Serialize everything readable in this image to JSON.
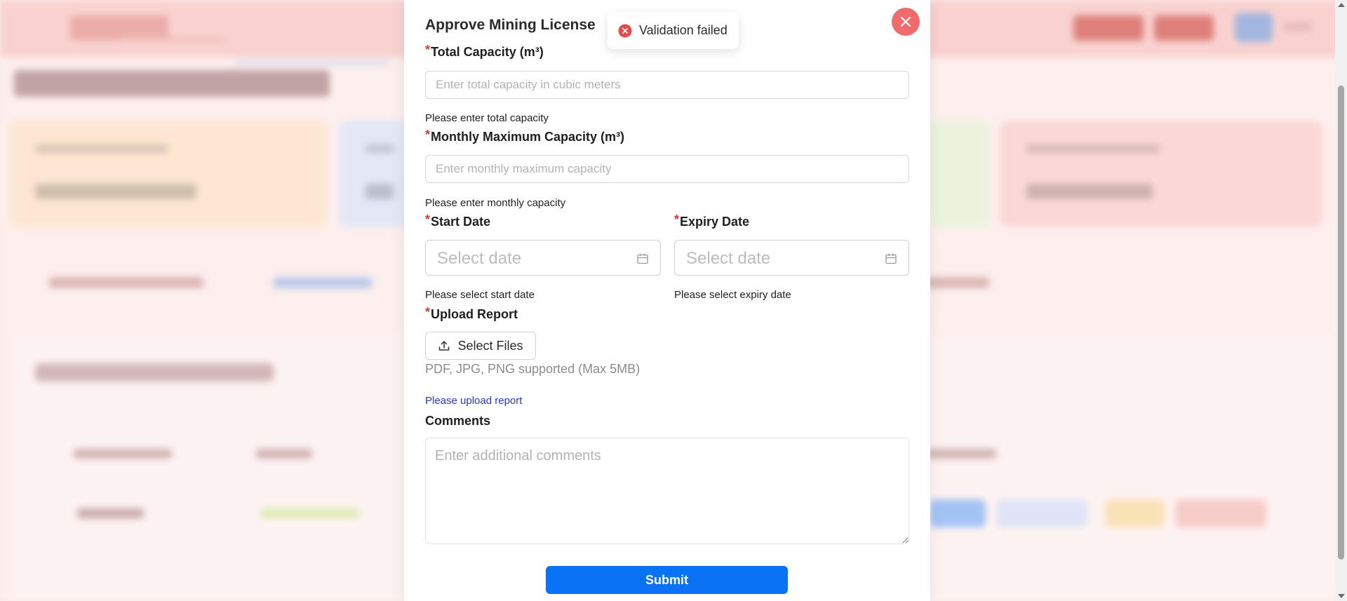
{
  "toast": {
    "message": "Validation failed",
    "icon": "error-circle-icon",
    "color": "#e84a4a"
  },
  "modal": {
    "title": "Approve Mining License",
    "close_icon": "close-icon",
    "fields": {
      "total_capacity": {
        "label": "Total Capacity (m³)",
        "required_mark": "*",
        "placeholder": "Enter total capacity in cubic meters",
        "value": "",
        "error": "Please enter total capacity"
      },
      "monthly_capacity": {
        "label": "Monthly Maximum Capacity (m³)",
        "required_mark": "*",
        "placeholder": "Enter monthly maximum capacity",
        "value": "",
        "error": "Please enter monthly capacity"
      },
      "start_date": {
        "label": "Start Date",
        "required_mark": "*",
        "placeholder": "Select date",
        "value": "",
        "error": "Please select start date",
        "icon": "calendar-icon"
      },
      "expiry_date": {
        "label": "Expiry Date",
        "required_mark": "*",
        "placeholder": "Select date",
        "value": "",
        "error": "Please select expiry date",
        "icon": "calendar-icon"
      },
      "upload_report": {
        "label": "Upload Report",
        "required_mark": "*",
        "button_label": "Select Files",
        "button_icon": "upload-icon",
        "hint": "PDF, JPG, PNG supported (Max 5MB)",
        "error": "Please upload report"
      },
      "comments": {
        "label": "Comments",
        "placeholder": "Enter additional comments",
        "value": ""
      }
    },
    "submit_label": "Submit"
  },
  "colors": {
    "accent": "#0a73f5",
    "required": "#e03535",
    "close_button": "#f26b6b",
    "link_error": "#2438d6"
  }
}
